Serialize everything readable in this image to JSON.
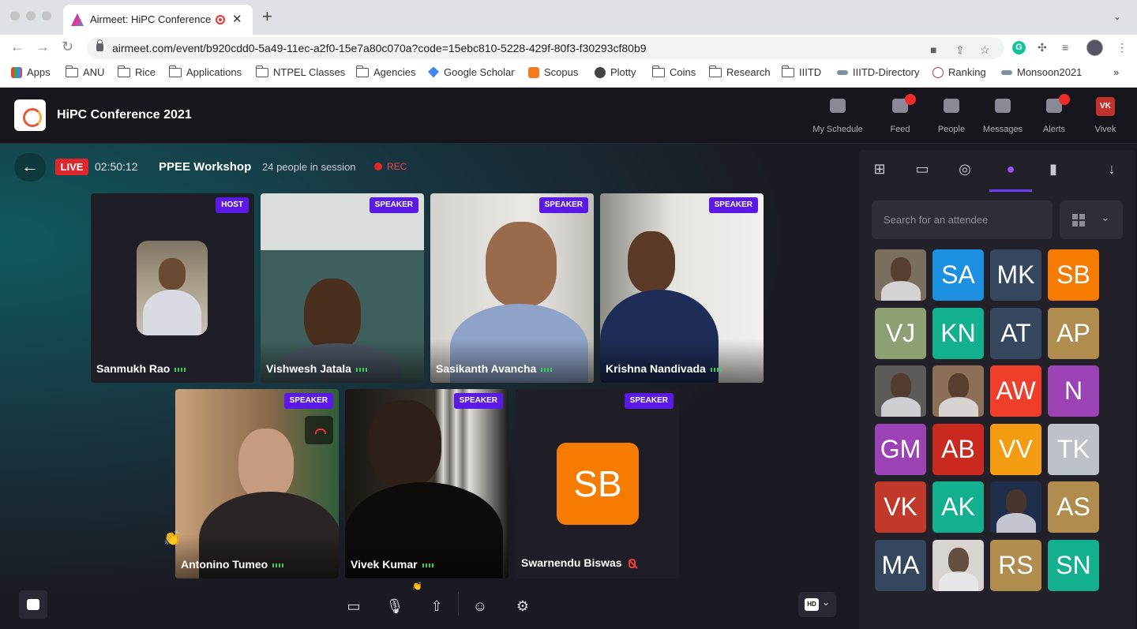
{
  "browser": {
    "tab_title": "Airmeet: HiPC Conference",
    "url": "airmeet.com/event/b920cdd0-5a49-11ec-a2f0-15e7a80c070a?code=15ebc810-5228-429f-80f3-f30293cf80b9",
    "bookmarks": [
      "Apps",
      "ANU",
      "Rice",
      "Applications",
      "NTPEL Classes",
      "Agencies",
      "Google Scholar",
      "Scopus",
      "Plotty",
      "Coins",
      "Research",
      "IIITD",
      "IIITD-Directory",
      "Ranking",
      "Monsoon2021"
    ]
  },
  "header": {
    "event_title": "HiPC Conference 2021",
    "nav": [
      {
        "label": "My Schedule",
        "icon": "calendar-icon",
        "dot": false
      },
      {
        "label": "Feed",
        "icon": "feed-icon",
        "dot": true
      },
      {
        "label": "People",
        "icon": "people-icon",
        "dot": false
      },
      {
        "label": "Messages",
        "icon": "messages-icon",
        "dot": false
      },
      {
        "label": "Alerts",
        "icon": "bell-icon",
        "dot": true
      },
      {
        "label": "Vivek",
        "icon": "user-avatar",
        "dot": false,
        "initials": "VK"
      }
    ]
  },
  "session": {
    "live": "LIVE",
    "timer": "02:50:12",
    "title": "PPEE Workshop",
    "people_count": "24 people in session",
    "rec": "REC"
  },
  "tiles": [
    {
      "name": "Sanmukh Rao",
      "role": "HOST",
      "mic": "on"
    },
    {
      "name": "Vishwesh Jatala",
      "role": "SPEAKER",
      "mic": "on"
    },
    {
      "name": "Sasikanth Avancha",
      "role": "SPEAKER",
      "mic": "on"
    },
    {
      "name": "Krishna Nandivada",
      "role": "SPEAKER",
      "mic": "on"
    },
    {
      "name": "Antonino Tumeo",
      "role": "SPEAKER",
      "mic": "on"
    },
    {
      "name": "Vivek Kumar",
      "role": "SPEAKER",
      "mic": "on"
    },
    {
      "name": "Swarnendu Biswas",
      "role": "SPEAKER",
      "mic": "muted",
      "initials": "SB"
    }
  ],
  "controls": {
    "quality": "HD"
  },
  "panel": {
    "search_placeholder": "Search for an attendee",
    "attendees": [
      {
        "initials": "",
        "photo": true,
        "color": "#7a6f5e"
      },
      {
        "initials": "SA",
        "color": "#1b8fe0"
      },
      {
        "initials": "MK",
        "color": "#34475e"
      },
      {
        "initials": "SB",
        "color": "#f57c00"
      },
      {
        "initials": "VJ",
        "color": "#8e9f73"
      },
      {
        "initials": "KN",
        "color": "#12b08e"
      },
      {
        "initials": "AT",
        "color": "#34475e"
      },
      {
        "initials": "AP",
        "color": "#b08d4e"
      },
      {
        "initials": "",
        "photo": true,
        "color": "#5d5b5a"
      },
      {
        "initials": "",
        "photo": true,
        "color": "#8b6f56"
      },
      {
        "initials": "AW",
        "color": "#ef3e2a"
      },
      {
        "initials": "N",
        "color": "#9b42b4"
      },
      {
        "initials": "GM",
        "color": "#9b42b4"
      },
      {
        "initials": "AB",
        "color": "#c9291f"
      },
      {
        "initials": "VV",
        "color": "#f39c12"
      },
      {
        "initials": "TK",
        "color": "#bcc2c7"
      },
      {
        "initials": "VK",
        "color": "#c0392b"
      },
      {
        "initials": "AK",
        "color": "#12b08e"
      },
      {
        "initials": "",
        "photo": true,
        "color": "#1f2e4a"
      },
      {
        "initials": "AS",
        "color": "#b08d4e"
      },
      {
        "initials": "MA",
        "color": "#34475e"
      },
      {
        "initials": "",
        "photo": true,
        "color": "#d8d5d0"
      },
      {
        "initials": "RS",
        "color": "#b08d4e"
      },
      {
        "initials": "SN",
        "color": "#12b08e"
      }
    ]
  }
}
